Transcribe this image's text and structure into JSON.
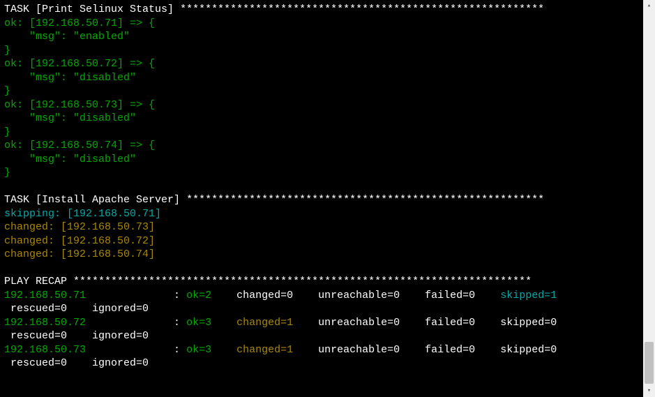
{
  "task1": {
    "header_prefix": "TASK [",
    "header_name": "Print Selinux Status",
    "header_suffix": "] ",
    "header_stars": "**********************************************************",
    "hosts": [
      {
        "ip": "192.168.50.71",
        "status": "enabled"
      },
      {
        "ip": "192.168.50.72",
        "status": "disabled"
      },
      {
        "ip": "192.168.50.73",
        "status": "disabled"
      },
      {
        "ip": "192.168.50.74",
        "status": "disabled"
      }
    ]
  },
  "task2": {
    "header_prefix": "TASK [",
    "header_name": "Install Apache Server",
    "header_suffix": "] ",
    "header_stars": "*********************************************************",
    "results": [
      {
        "state": "skipping",
        "ip": "192.168.50.71",
        "color": "cyan"
      },
      {
        "state": "changed",
        "ip": "192.168.50.73",
        "color": "yellow"
      },
      {
        "state": "changed",
        "ip": "192.168.50.72",
        "color": "yellow"
      },
      {
        "state": "changed",
        "ip": "192.168.50.74",
        "color": "yellow"
      }
    ]
  },
  "recap": {
    "header_prefix": "PLAY RECAP ",
    "header_stars": "*************************************************************************",
    "rows": [
      {
        "ip": "192.168.50.71",
        "ok": "ok=2",
        "changed": "changed=0",
        "unreachable": "unreachable=0",
        "failed": "failed=0",
        "skipped": "skipped=1",
        "skipped_color": "cyan",
        "rescued": "rescued=0",
        "ignored": "ignored=0",
        "changed_color": "white"
      },
      {
        "ip": "192.168.50.72",
        "ok": "ok=3",
        "changed": "changed=1",
        "unreachable": "unreachable=0",
        "failed": "failed=0",
        "skipped": "skipped=0",
        "skipped_color": "white",
        "rescued": "rescued=0",
        "ignored": "ignored=0",
        "changed_color": "yellow"
      },
      {
        "ip": "192.168.50.73",
        "ok": "ok=3",
        "changed": "changed=1",
        "unreachable": "unreachable=0",
        "failed": "failed=0",
        "skipped": "skipped=0",
        "skipped_color": "white",
        "rescued": "rescued=0",
        "ignored": "ignored=0",
        "changed_color": "yellow"
      }
    ]
  }
}
